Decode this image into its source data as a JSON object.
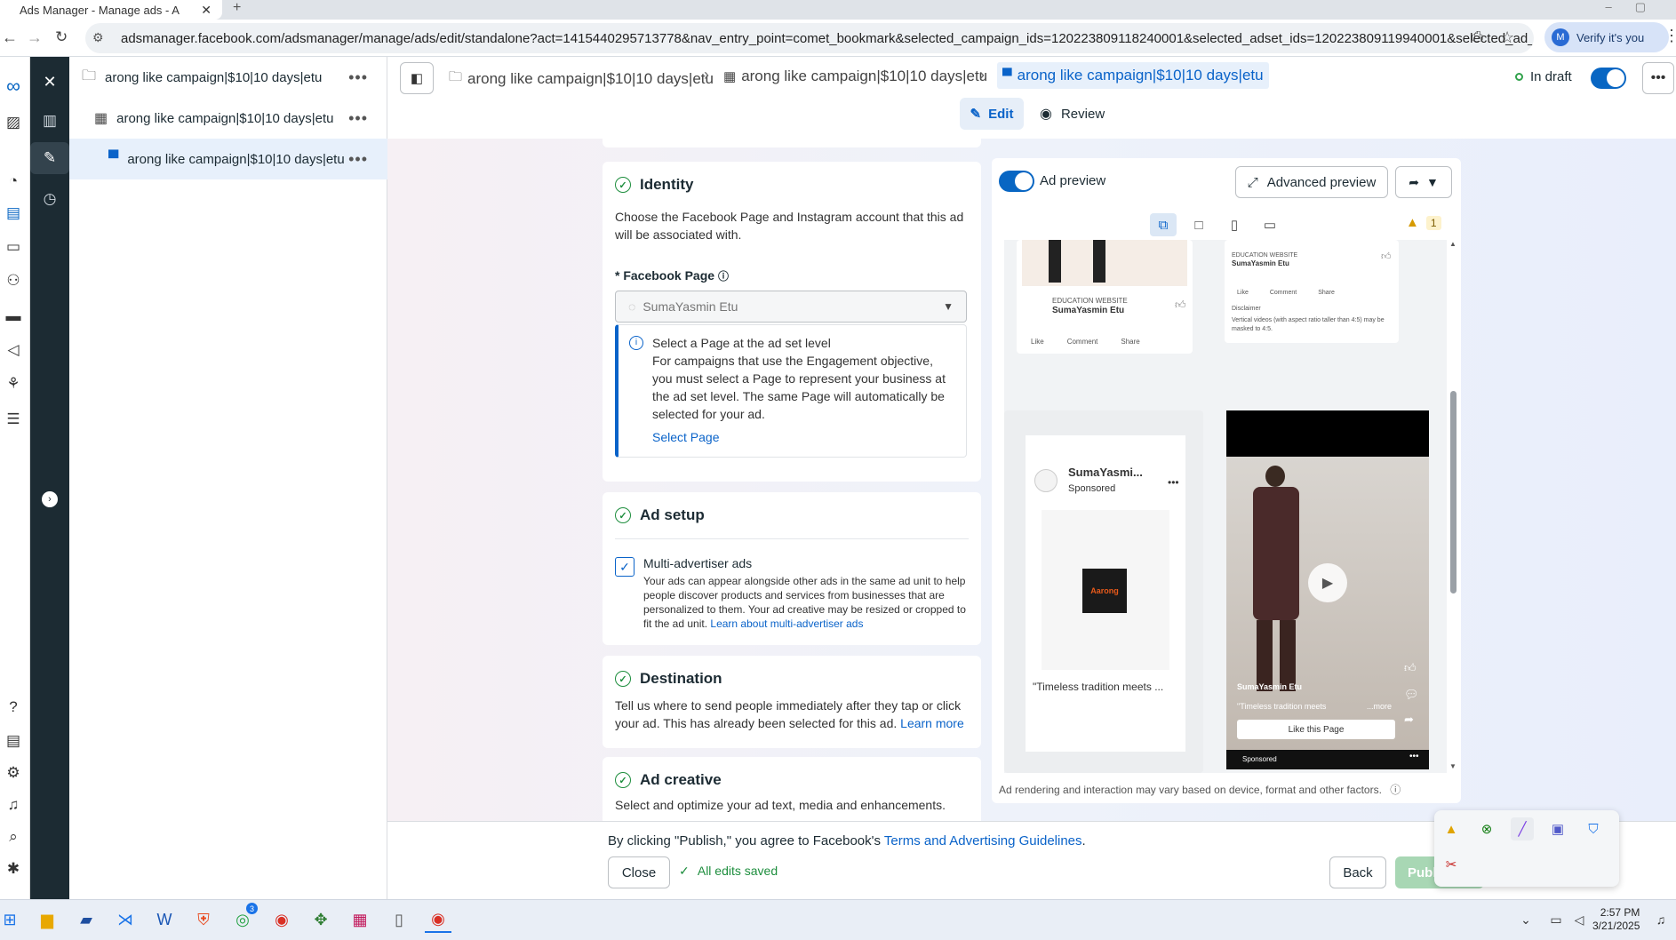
{
  "browser": {
    "tab_title": "Ads Manager - Manage ads - A",
    "url": "adsmanager.facebook.com/adsmanager/manage/ads/edit/standalone?act=1415440295713778&nav_entry_point=comet_bookmark&selected_campaign_ids=120223809118240001&selected_adset_ids=120223809119940001&selected_ad_ids=12...",
    "verify_label": "Verify it's you",
    "avatar_letter": "M"
  },
  "tree": {
    "campaign": "arong like campaign|$10|10 days|etu",
    "adset": "arong like campaign|$10|10 days|etu",
    "ad": "arong like campaign|$10|10 days|etu"
  },
  "header": {
    "crumb1": "arong like campaign|$10|10 days|etu",
    "crumb2": "arong like campaign|$10|10 days|etu",
    "crumb3": "arong like campaign|$10|10 days|etu",
    "status": "In draft",
    "edit_tab": "Edit",
    "review_tab": "Review"
  },
  "identity": {
    "title": "Identity",
    "desc": "Choose the Facebook Page and Instagram account that this ad will be associated with.",
    "fb_page_label": "* Facebook Page",
    "fb_page_value": "SumaYasmin Etu",
    "info_title": "Select a Page at the ad set level",
    "info_body": "For campaigns that use the Engagement objective, you must select a Page to represent your business at the ad set level. The same Page will automatically be selected for your ad.",
    "info_link": "Select Page"
  },
  "ad_setup": {
    "title": "Ad setup",
    "checkbox_label": "Multi-advertiser ads",
    "checkbox_desc": "Your ads can appear alongside other ads in the same ad unit to help people discover products and services from businesses that are personalized to them. Your ad creative may be resized or cropped to fit the ad unit.",
    "learn_link": "Learn about multi-advertiser ads"
  },
  "destination": {
    "title": "Destination",
    "desc": "Tell us where to send people immediately after they tap or click your ad. This has already been selected for this ad.",
    "learn_link": "Learn more"
  },
  "ad_creative": {
    "title": "Ad creative",
    "desc": "Select and optimize your ad text, media and enhancements."
  },
  "preview": {
    "toggle_label": "Ad preview",
    "advanced_label": "Advanced preview",
    "warning_count": "1",
    "card1_kicker": "EDUCATION WEBSITE",
    "card1_name": "SumaYasmin Etu",
    "card2_kicker": "EDUCATION WEBSITE",
    "card2_name": "SumaYasmin Etu",
    "disclaimer_title": "Disclaimer",
    "disclaimer_text": "Vertical videos (with aspect ratio taller than 4:5) may be masked to 4:5.",
    "like": "Like",
    "comment": "Comment",
    "share": "Share",
    "story_name": "SumaYasmi...",
    "story_sponsored": "Sponsored",
    "story_caption": "\"Timeless tradition meets ...",
    "brand_logo_text": "Aarong",
    "reel_name": "SumaYasmin Etu",
    "reel_caption": "\"Timeless tradition meets",
    "reel_more": "...more",
    "reel_cta": "Like this Page",
    "reel_sponsored": "Sponsored",
    "footnote": "Ad rendering and interaction may vary based on device, format and other factors."
  },
  "footer": {
    "terms_prefix": "By clicking \"Publish,\" you agree to Facebook's ",
    "terms_link": "Terms and Advertising Guidelines",
    "terms_suffix": ".",
    "close_label": "Close",
    "saved_label": "All edits saved",
    "back_label": "Back",
    "publish_label": "Publish"
  },
  "taskbar": {
    "time": "2:57 PM",
    "date": "3/21/2025",
    "whatsapp_badge": "3"
  },
  "colors": {
    "accent": "#0a63c9",
    "rail": "#1c2b33",
    "success": "#1e8e3e"
  }
}
